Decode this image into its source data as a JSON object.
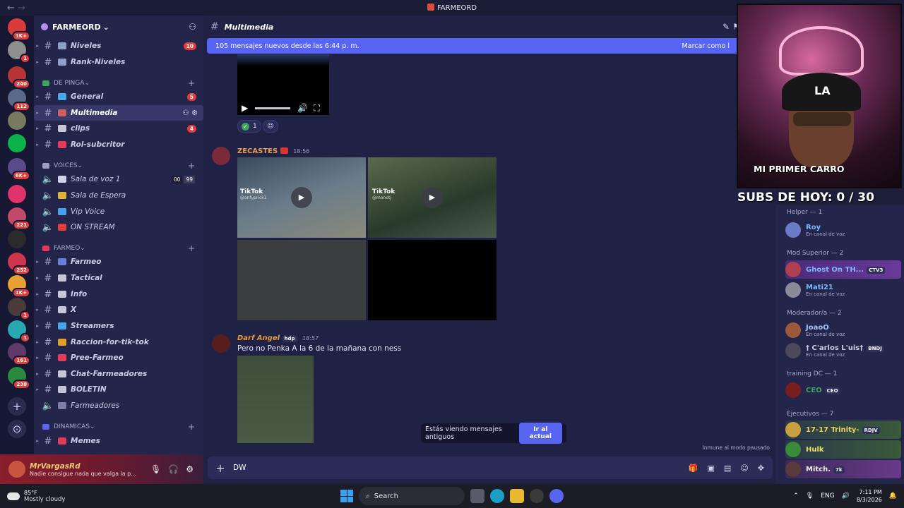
{
  "window": {
    "title": "FARMEORD",
    "nav_back": "←",
    "nav_forward": "→"
  },
  "rail": {
    "servers": [
      {
        "color": "#d93a3a",
        "badge": "1K+"
      },
      {
        "color": "#8e8e8e",
        "badge": "1"
      },
      {
        "color": "#b83333",
        "badge": "240"
      },
      {
        "color": "#5b6a8a",
        "badge": "112"
      },
      {
        "color": "#777a60",
        "badge": ""
      },
      {
        "color": "#0ab24a",
        "badge": ""
      },
      {
        "color": "#5a4b8a",
        "badge": "6K+"
      },
      {
        "color": "#e0336c",
        "badge": ""
      },
      {
        "color": "#c14a6a",
        "badge": "221"
      },
      {
        "color": "#2b2b2b",
        "badge": ""
      },
      {
        "color": "#d1354e",
        "badge": "252"
      },
      {
        "color": "#e8a030",
        "badge": "1K+"
      },
      {
        "color": "#4a3a3a",
        "badge": "1"
      },
      {
        "color": "#28a8b0",
        "badge": "1"
      },
      {
        "color": "#603a6a",
        "badge": "161"
      },
      {
        "color": "#2c8a3c",
        "badge": "238"
      }
    ],
    "add_label": "+",
    "discover_label": "⊙"
  },
  "sidebar": {
    "guild_name": "FARMEORD",
    "guild_chevron": "⌄",
    "channels_top": [
      {
        "name": "Niveles",
        "count": "10",
        "emo": "#8fa0c8"
      },
      {
        "name": "Rank-Niveles",
        "count": "",
        "emo": "#8fa0c8"
      }
    ],
    "cat1": "DE PINGA",
    "cat1_channels": [
      {
        "name": "General",
        "count": "5",
        "emo": "#47a7e8"
      },
      {
        "name": "Multimedia",
        "count": "",
        "emo": "#d06060"
      },
      {
        "name": "clips",
        "count": "4",
        "emo": "#c6c6d6"
      },
      {
        "name": "Rol-subcritor",
        "count": "",
        "emo": "#e23c5a"
      }
    ],
    "cat2": "VOICES",
    "voice_channels": [
      {
        "name": "Sala de voz 1",
        "emo": "#cfd3e8"
      },
      {
        "name": "Sala de Espera",
        "emo": "#e0b040"
      },
      {
        "name": "Vip Voice",
        "emo": "#44a3f0"
      },
      {
        "name": "ON STREAM",
        "emo": "#e23c3c"
      }
    ],
    "voice_occ": {
      "a": "00",
      "b": "99"
    },
    "cat3": "FARMEO",
    "cat3_channels": [
      {
        "name": "Farmeo",
        "emo": "#6a80d8"
      },
      {
        "name": "Tactical",
        "emo": "#c6c6d6"
      },
      {
        "name": "Info",
        "emo": "#c6c6d6"
      },
      {
        "name": "X",
        "emo": "#c6c6d6"
      },
      {
        "name": "Streamers",
        "emo": "#47a7e8"
      },
      {
        "name": "Raccion-for-tik-tok",
        "emo": "#e0a030"
      },
      {
        "name": "Pree-Farmeo",
        "emo": "#e23c5a"
      },
      {
        "name": "Chat-Farmeadores",
        "emo": "#c6c6d6"
      },
      {
        "name": "BOLETIN",
        "emo": "#c6c6d6"
      },
      {
        "name": "Farmeadores",
        "emo": "#7a7fa8"
      }
    ],
    "cat4": "DINAMICAS",
    "cat4_channels": [
      {
        "name": "Memes",
        "emo": "#e23c5a"
      }
    ]
  },
  "user": {
    "name": "MrVargasRd",
    "status": "Nadie consigue nada que valga la p..."
  },
  "channel": {
    "name": "Multimedia"
  },
  "newbar": {
    "text": "105 mensajes nuevos desde las 6:44 p. m.",
    "mark": "Marcar como l"
  },
  "reaction": {
    "count": "1"
  },
  "messages": [
    {
      "author": "ZECASTES",
      "time": "18:56",
      "color": "#e8a04a"
    },
    {
      "author": "Darf Angel",
      "time": "18:57",
      "color": "#e89a3c",
      "tag": "hdp",
      "text": "Pero no Penka A la 6 de la mañana con ness"
    }
  ],
  "tiktok": {
    "label": "TikTok",
    "handle1": "@anfyprick1",
    "handle2": "@monotj"
  },
  "toast": {
    "text": "Estás viendo mensajes antiguos",
    "button": "Ir al actual"
  },
  "paused": "Inmune al modo pausado",
  "composer": {
    "value": "DW"
  },
  "cam": {
    "overlay_text": "MI PRIMER CARRO",
    "cap_logo": "LA"
  },
  "subs": "SUBS DE HOY: 0 / 30",
  "members": {
    "roles": [
      {
        "name": "Helper — 1"
      },
      {
        "name": "Mod Superior — 2"
      },
      {
        "name": "Moderador/a — 2"
      },
      {
        "name": "training DC — 1"
      },
      {
        "name": "Ejecutivos — 7"
      }
    ],
    "list": [
      {
        "name": "Roy",
        "sub": "En canal de voz",
        "color": "#7ab8ff",
        "av": "#6a7bc8",
        "tag": ""
      },
      {
        "name": "Ghost On TH...",
        "sub": "",
        "color": "#7ab8ff",
        "av": "#b04050",
        "tag": "CTV3"
      },
      {
        "name": "Mati21",
        "sub": "En canal de voz",
        "color": "#7ab8ff",
        "av": "#8a8a9a",
        "tag": ""
      },
      {
        "name": "JoaoO",
        "sub": "En canal de voz",
        "color": "#a7c7ff",
        "av": "#9a5a3a",
        "tag": ""
      },
      {
        "name": "† C'arlos L'uis†",
        "sub": "En canal de voz",
        "color": "#c8cce8",
        "av": "#4a4a5a",
        "tag": "BNDJ"
      },
      {
        "name": "CEO",
        "sub": "",
        "color": "#3ba55c",
        "av": "#7a1d1d",
        "tag": "CEO"
      },
      {
        "name": "17-17 Trinity-",
        "sub": "",
        "color": "#f0d060",
        "av": "#c8a040",
        "tag": "RDJV"
      },
      {
        "name": "Hulk",
        "sub": "",
        "color": "#f0e060",
        "av": "#3a8a3a",
        "tag": ""
      },
      {
        "name": "Mitch.",
        "sub": "",
        "color": "#f0f0f0",
        "av": "#5a3a3a",
        "tag": "7k"
      }
    ]
  },
  "taskbar": {
    "weather_temp": "85°F",
    "weather_desc": "Mostly cloudy",
    "search": "Search",
    "lang": "ENG",
    "time": "7:11 PM",
    "date": "8/3/2026"
  }
}
